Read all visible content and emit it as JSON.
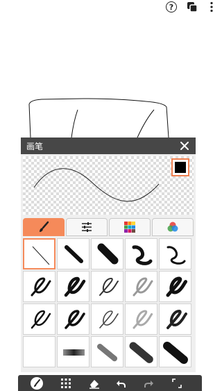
{
  "top_icons": [
    "help-circle-icon",
    "layers-icon",
    "more-vertical-icon"
  ],
  "help_glyph": "?",
  "panel": {
    "title": "画笔",
    "close_icon": "close-icon",
    "current_color": "#000000",
    "accent_color": "#f58a5a",
    "tabs": [
      {
        "name": "brush-tab",
        "icon": "brush-icon",
        "active": true
      },
      {
        "name": "settings-tab",
        "icon": "sliders-icon",
        "active": false
      },
      {
        "name": "palette-tab",
        "icon": "color-grid-icon",
        "active": false
      },
      {
        "name": "color-wheel-tab",
        "icon": "rgb-circles-icon",
        "active": false
      }
    ],
    "brushes": [
      [
        "thin-line",
        "round-marker",
        "thick-marker",
        "curve-stroke",
        "thin-curve"
      ],
      [
        "pen-solid",
        "pen-bold",
        "pen-outline",
        "pen-pencil",
        "pen-spray"
      ],
      [
        "pen-solid-2",
        "pen-bold-2",
        "pen-outline-2",
        "pen-pencil-2",
        "pen-spray-2"
      ],
      [
        "airbrush-soft",
        "airbrush-hard",
        "sprinkle",
        "spray-dots",
        "spray-splatter"
      ]
    ],
    "selected_brush": "thin-line"
  },
  "toolbar": {
    "items": [
      "brush-tool-icon",
      "grid-icon",
      "eraser-icon",
      "undo-icon",
      "redo-icon",
      "fullscreen-icon"
    ]
  }
}
